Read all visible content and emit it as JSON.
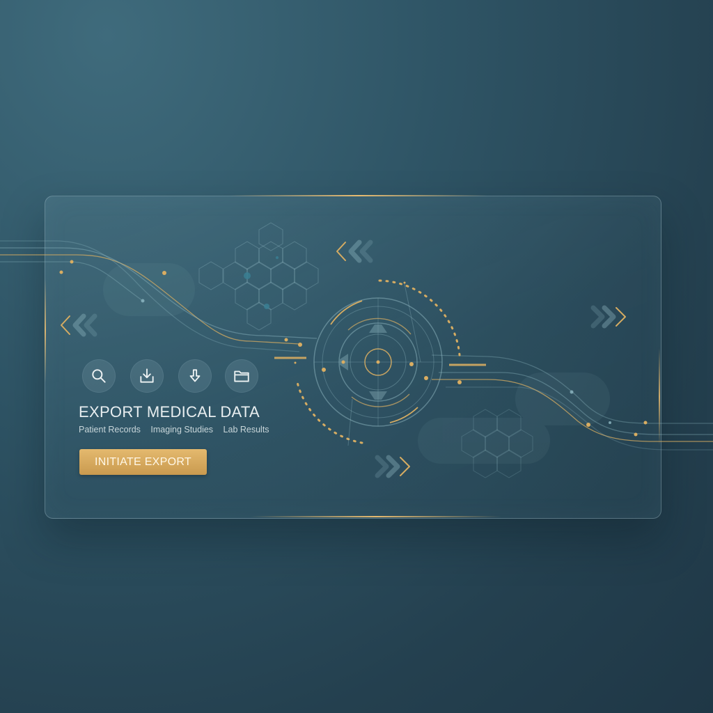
{
  "panel": {
    "title": "EXPORT MEDICAL DATA",
    "categories": [
      "Patient Records",
      "Imaging Studies",
      "Lab Results"
    ],
    "export_button_label": "INITIATE EXPORT"
  },
  "toolbar_icons": [
    "search-icon",
    "download-tray-icon",
    "arrow-down-icon",
    "folder-icon"
  ],
  "colors": {
    "background": "#2c4d5d",
    "accent_gold": "#d9ad62",
    "text": "#e8eef0"
  }
}
